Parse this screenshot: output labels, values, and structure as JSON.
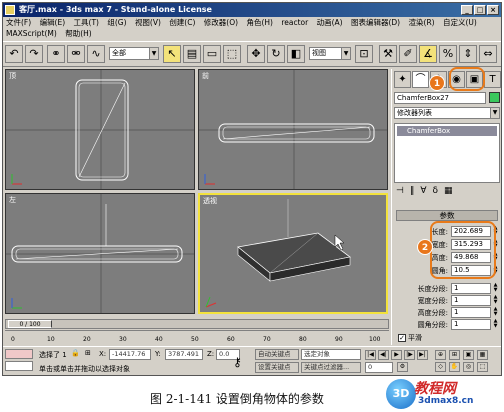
{
  "window": {
    "title": "客厅.max - 3ds max 7 - Stand-alone License",
    "buttons": [
      "_",
      "□",
      "×"
    ]
  },
  "menus": {
    "row1": [
      "文件(F)",
      "编辑(E)",
      "工具(T)",
      "组(G)",
      "视图(V)",
      "创建(C)",
      "修改器(O)",
      "角色(H)",
      "reactor",
      "动画(A)",
      "图表编辑器(D)",
      "渲染(R)",
      "自定义(U)"
    ],
    "row2": [
      "MAXScript(M)",
      "帮助(H)"
    ]
  },
  "toolbar": {
    "selection_filter": "全部",
    "coord_system": "视图"
  },
  "viewports": [
    {
      "label": "顶"
    },
    {
      "label": "前"
    },
    {
      "label": "左"
    },
    {
      "label": "透视",
      "active": true
    }
  ],
  "command_panel": {
    "object_name": "ChamferBox27",
    "object_color": "#3ac85c",
    "modifier_list": "修改器列表",
    "stack_item": "ChamferBox",
    "rollout_title": "参数",
    "params": [
      {
        "label": "长度:",
        "value": "202.689"
      },
      {
        "label": "宽度:",
        "value": "315.293"
      },
      {
        "label": "高度:",
        "value": "49.868"
      },
      {
        "label": "圆角:",
        "value": "10.5"
      }
    ],
    "segments": [
      {
        "label": "长度分段:",
        "value": "1"
      },
      {
        "label": "宽度分段:",
        "value": "1"
      },
      {
        "label": "高度分段:",
        "value": "1"
      },
      {
        "label": "圆角分段:",
        "value": "1"
      }
    ],
    "smooth_label": "平滑",
    "smooth_checked": true
  },
  "callouts": {
    "one": "1",
    "two": "2"
  },
  "timeline": {
    "frame_display": "0 / 100",
    "ticks": [
      "0",
      "10",
      "20",
      "30",
      "40",
      "50",
      "60",
      "70",
      "80",
      "90",
      "100"
    ]
  },
  "status": {
    "selection": "选择了 1",
    "x_label": "X:",
    "x_value": "-14417.76",
    "y_label": "Y:",
    "y_value": "3787.491",
    "z_label": "Z:",
    "z_value": "0.0",
    "auto_key": "自动关键点",
    "key_filter_sel": "选定对象",
    "set_key": "设置关键点",
    "key_filters": "关键点过滤器...",
    "prompt": "单击或单击并拖动以选择对象",
    "frame": "0"
  },
  "caption": "图 2-1-141   设置倒角物体的参数",
  "watermark": {
    "badge": "3D",
    "title": "教程网",
    "site": "3dmax8.cn"
  },
  "colors": {
    "accent": "#e87a1a",
    "active_viewport": "#f3e23c",
    "title_bar": "#0a246a"
  }
}
